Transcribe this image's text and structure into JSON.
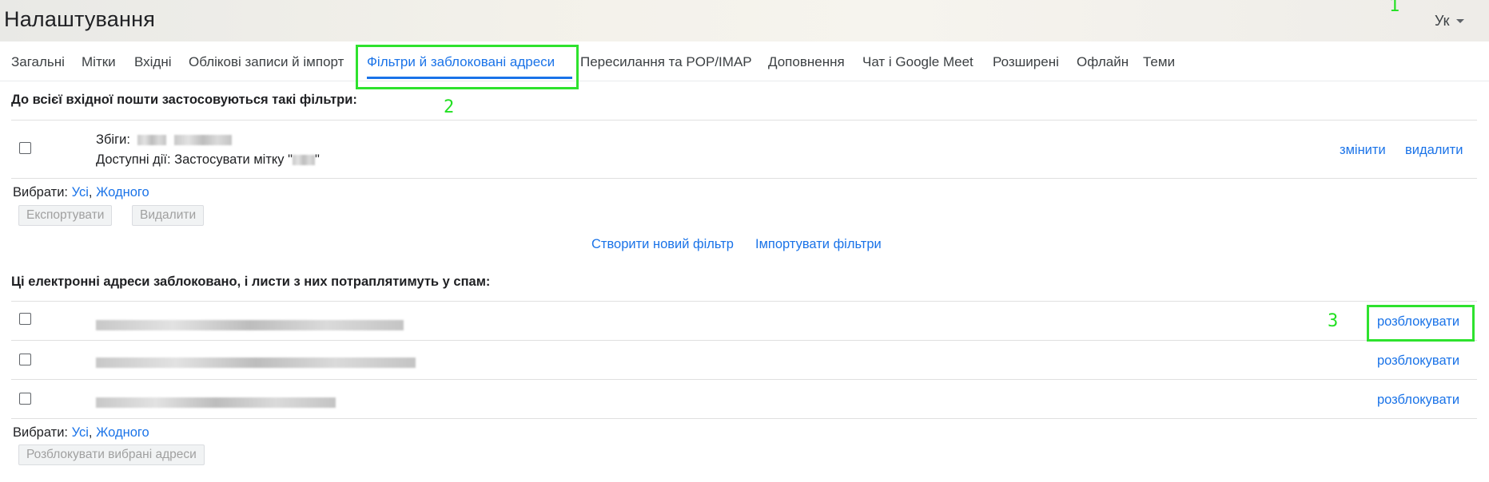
{
  "header": {
    "title": "Налаштування",
    "language": "Ук"
  },
  "tabs": [
    {
      "label": "Загальні"
    },
    {
      "label": "Мітки"
    },
    {
      "label": "Вхідні"
    },
    {
      "label": "Облікові записи й імпорт"
    },
    {
      "label": "Фільтри й заблоковані адреси",
      "active": true
    },
    {
      "label": "Пересилання та POP/IMAP"
    },
    {
      "label": "Доповнення"
    },
    {
      "label": "Чат і Google Meet"
    },
    {
      "label": "Розширені"
    },
    {
      "label": "Офлайн"
    },
    {
      "label": "Теми"
    }
  ],
  "filters": {
    "heading": "До всієї вхідної пошти застосовуються такі фільтри:",
    "items": [
      {
        "matches_label": "Збіги:",
        "actions_label": "Доступні дії: Застосувати мітку \"",
        "actions_suffix": "\"",
        "edit": "змінити",
        "delete": "видалити"
      }
    ],
    "select_label": "Вибрати:",
    "select_all": "Усі",
    "select_none": "Жодного",
    "export_button": "Експортувати",
    "delete_button": "Видалити",
    "create_filter": "Створити новий фільтр",
    "import_filters": "Імпортувати фільтри"
  },
  "blocked": {
    "heading": "Ці електронні адреси заблоковано, і листи з них потраплятимуть у спам:",
    "items": [
      {
        "unblock": "розблокувати"
      },
      {
        "unblock": "розблокувати"
      },
      {
        "unblock": "розблокувати"
      }
    ],
    "select_label": "Вибрати:",
    "select_all": "Усі",
    "select_none": "Жодного",
    "unblock_selected_button": "Розблокувати вибрані адреси"
  },
  "annotations": [
    "1",
    "2",
    "3"
  ],
  "colors": {
    "link": "#1a73e8",
    "highlight": "#2ee22e"
  }
}
